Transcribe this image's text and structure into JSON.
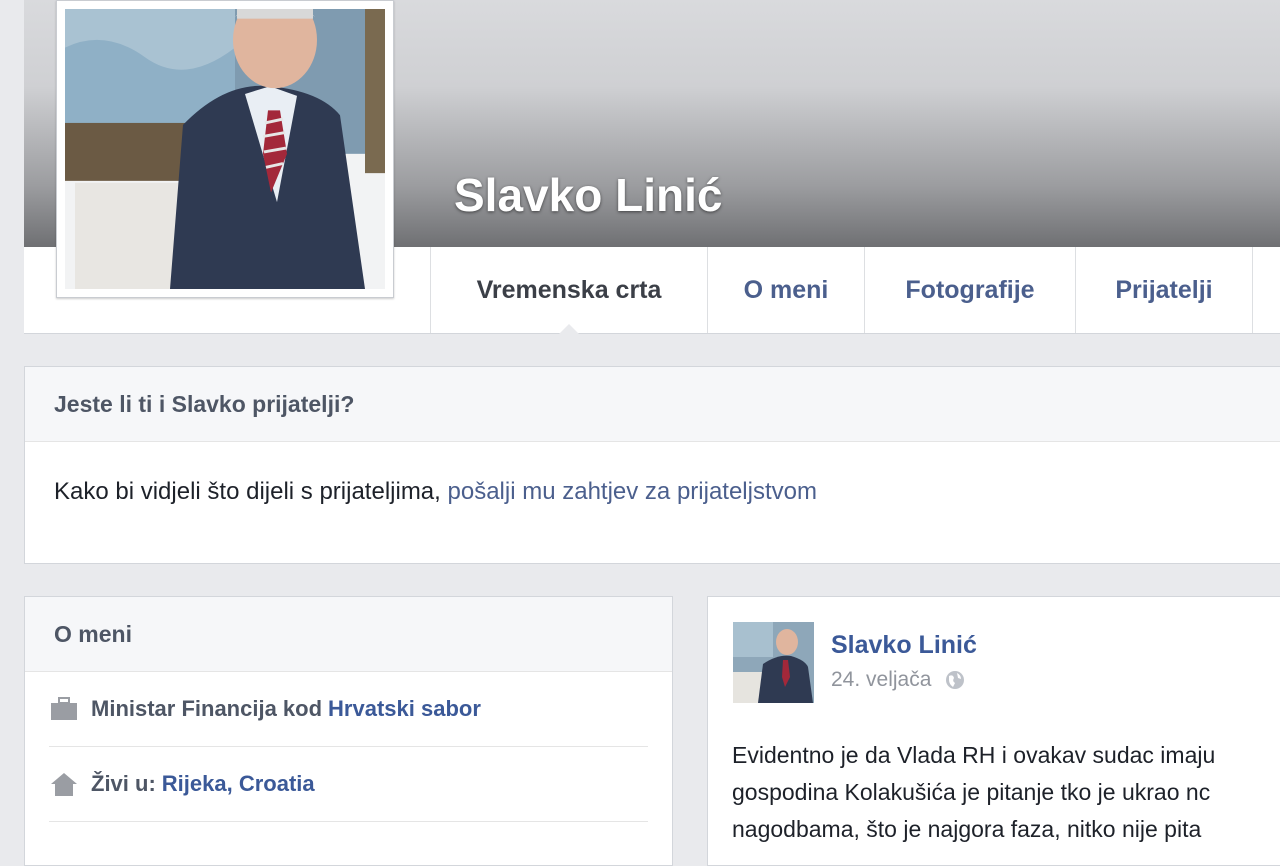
{
  "profile": {
    "name": "Slavko Linić"
  },
  "tabs": [
    {
      "label": "Vremenska crta",
      "active": true
    },
    {
      "label": "O meni"
    },
    {
      "label": "Fotografije"
    },
    {
      "label": "Prijatelji"
    }
  ],
  "friends_box": {
    "title": "Jeste li ti i Slavko prijatelji?",
    "text": "Kako bi vidjeli što dijeli s prijateljima,",
    "link": "pošalji mu zahtjev za prijateljstvom"
  },
  "about": {
    "title": "O meni",
    "work": {
      "prefix": "Ministar Financija kod",
      "link": "Hrvatski sabor",
      "icon": "briefcase-icon"
    },
    "lives": {
      "prefix": "Živi u:",
      "link": "Rijeka, Croatia",
      "icon": "home-icon"
    }
  },
  "post": {
    "author": "Slavko Linić",
    "date": "24. veljača",
    "privacy_icon": "globe-icon",
    "lines": [
      "Evidentno je da Vlada RH i ovakav sudac imaju",
      "gospodina Kolakušića je pitanje tko je ukrao nc",
      "nagodbama, što je najgora faza, nitko nije pita"
    ]
  },
  "colors": {
    "link": "#3b5998",
    "tab_text": "#4b5f8d",
    "page_bg": "#e9eaed"
  }
}
